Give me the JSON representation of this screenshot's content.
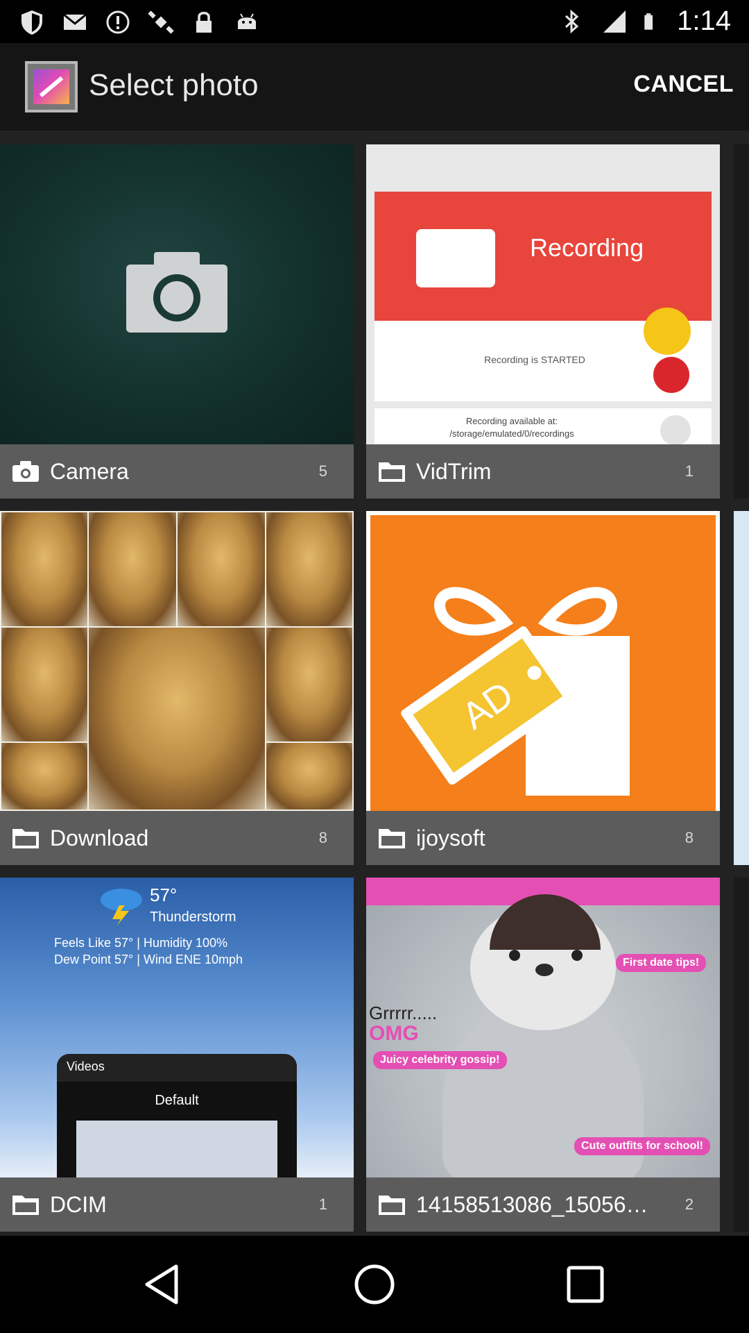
{
  "status_bar": {
    "time": "1:14",
    "left_icons": [
      "shield-icon",
      "mail-icon",
      "alert-icon",
      "satellite-icon",
      "lock-icon",
      "android-icon"
    ],
    "right_icons": [
      "bluetooth-icon",
      "signal-icon",
      "battery-icon"
    ]
  },
  "header": {
    "title": "Select photo",
    "cancel_label": "CANCEL"
  },
  "albums": [
    {
      "name": "Camera",
      "count": "5",
      "icon": "camera-icon"
    },
    {
      "name": "VidTrim",
      "count": "1",
      "icon": "folder-icon"
    },
    {
      "name": "Download",
      "count": "8",
      "icon": "folder-icon"
    },
    {
      "name": "ijoysoft",
      "count": "8",
      "icon": "folder-icon"
    },
    {
      "name": "DCIM",
      "count": "1",
      "icon": "folder-icon"
    },
    {
      "name": "14158513086_15056…",
      "count": "2",
      "icon": "folder-icon"
    }
  ],
  "thumbs": {
    "vidtrim": {
      "recording_label": "Recording",
      "started_text": "Recording is STARTED",
      "available_text": "Recording available at:",
      "path_text": "/storage/emulated/0/recordings"
    },
    "ijoysoft": {
      "ad_label": "AD"
    },
    "dcim": {
      "temp": "57°",
      "condition": "Thunderstorm",
      "details1": "Feels Like  57° | Humidity  100%",
      "details2": "Dew Point  57° | Wind  ENE 10mph",
      "videos_label": "Videos",
      "default_label": "Default"
    },
    "penguin": {
      "grr": "Grrrrr.....",
      "omg": "OMG",
      "gossip": "Juicy celebrity gossip!",
      "date_tips": "First date tips!",
      "outfits": "Cute outfits for school!"
    }
  },
  "nav": {
    "buttons": [
      "back-icon",
      "home-icon",
      "recents-icon"
    ]
  },
  "colors": {
    "status_bg": "#000000",
    "header_bg": "#151515",
    "grid_bg": "#222222",
    "label_bg": "#606060"
  }
}
